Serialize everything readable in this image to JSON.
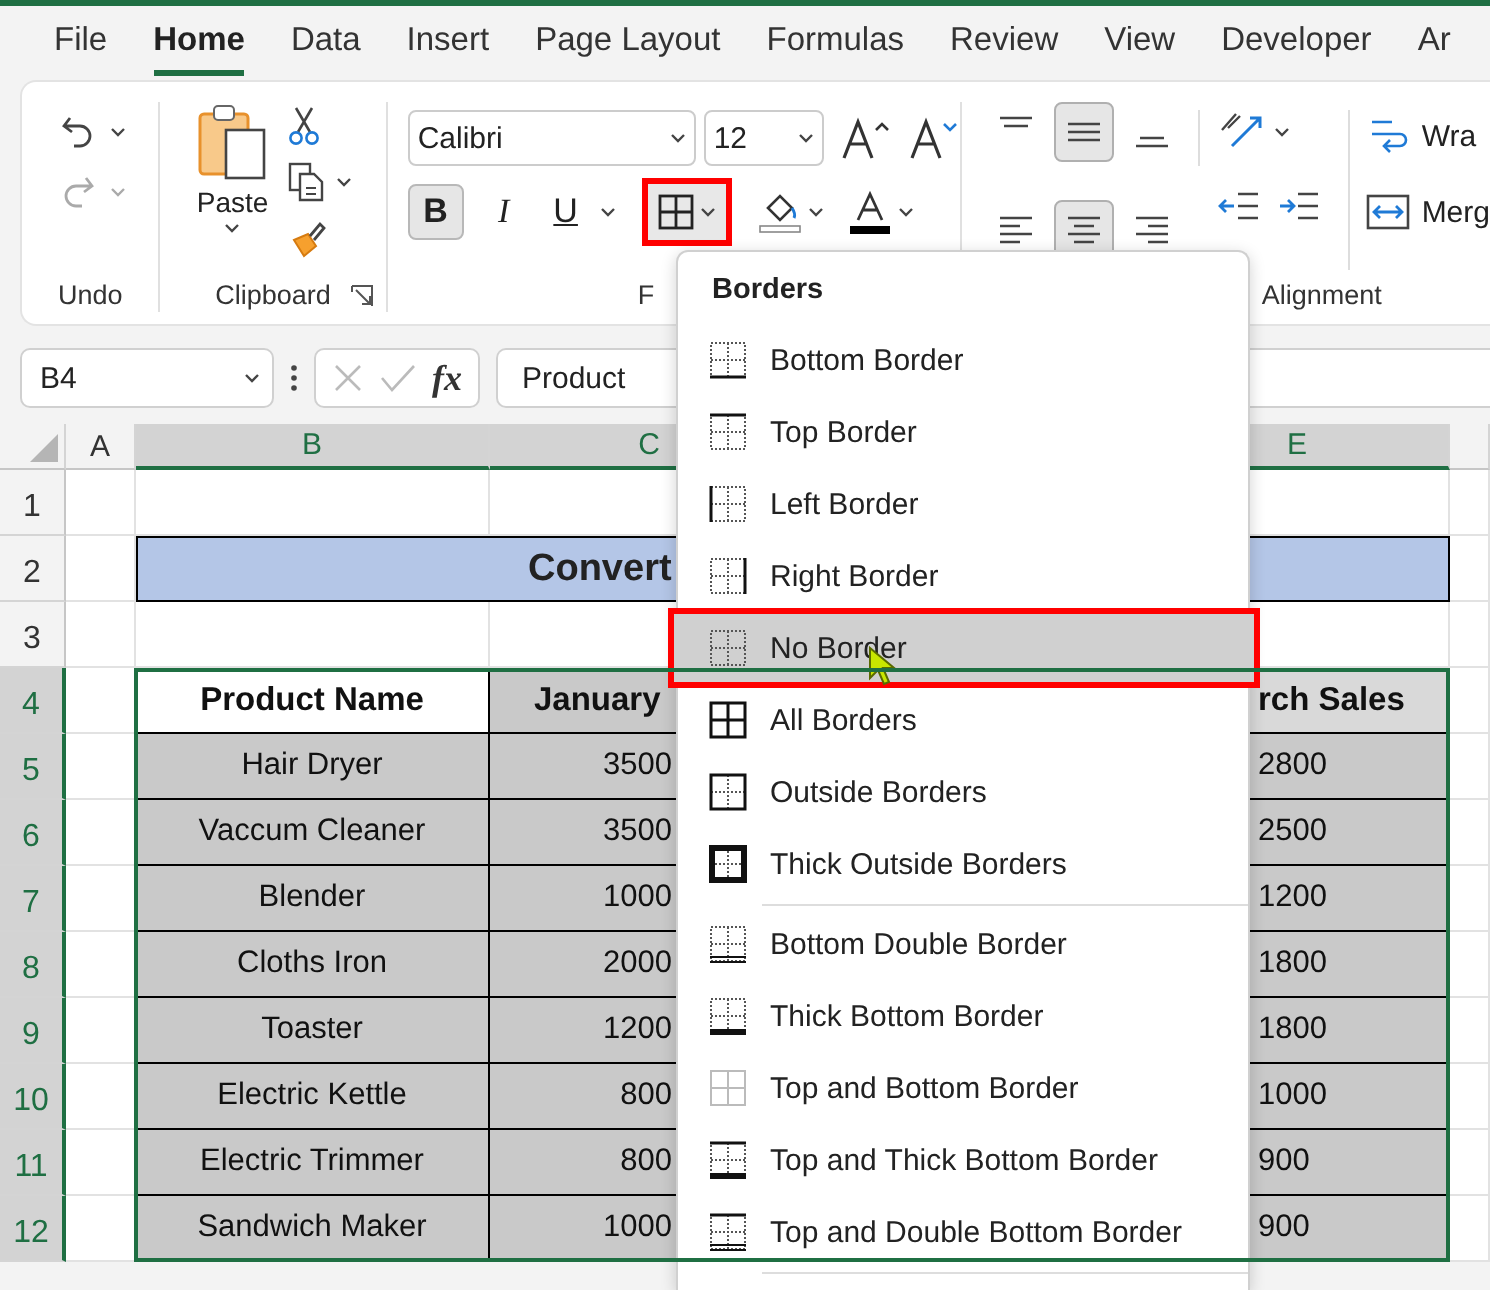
{
  "tabs": [
    {
      "label": "File",
      "selected": false
    },
    {
      "label": "Home",
      "selected": true
    },
    {
      "label": "Data",
      "selected": false
    },
    {
      "label": "Insert",
      "selected": false
    },
    {
      "label": "Page Layout",
      "selected": false
    },
    {
      "label": "Formulas",
      "selected": false
    },
    {
      "label": "Review",
      "selected": false
    },
    {
      "label": "View",
      "selected": false
    },
    {
      "label": "Developer",
      "selected": false
    },
    {
      "label": "Ar",
      "selected": false
    }
  ],
  "ribbon": {
    "groups": [
      {
        "kind": "undo",
        "label": "Undo"
      },
      {
        "kind": "clipboard",
        "label": "Clipboard",
        "paste_label": "Paste"
      },
      {
        "kind": "font",
        "label": "F",
        "font_name": "Calibri",
        "font_size": "12",
        "bold": {
          "label": "B",
          "on": true
        },
        "italic": "I",
        "underline": "U",
        "borders_highlighted": true
      },
      {
        "kind": "alignment",
        "label": "Alignment",
        "wrap_label": "Wra",
        "merge_label": "Merg",
        "align_buttons": [
          {
            "kind": "top",
            "selected": false
          },
          {
            "kind": "middle",
            "selected": true
          },
          {
            "kind": "bottom",
            "selected": false
          },
          {
            "kind": "left",
            "selected": false
          },
          {
            "kind": "center",
            "selected": true
          },
          {
            "kind": "right",
            "selected": false
          }
        ]
      }
    ]
  },
  "formula_bar": {
    "name_box": "B4",
    "function_label": "fx",
    "formula": "Product"
  },
  "sheet": {
    "columns": [
      {
        "label": "A",
        "selected": false
      },
      {
        "label": "B",
        "selected": true
      },
      {
        "label": "C",
        "selected": true
      },
      {
        "label": "E",
        "selected": true
      }
    ],
    "rows": [
      {
        "label": "1",
        "selected": false
      },
      {
        "label": "2",
        "selected": false
      },
      {
        "label": "3",
        "selected": false
      },
      {
        "label": "4",
        "selected": true
      },
      {
        "label": "5",
        "selected": true
      },
      {
        "label": "6",
        "selected": true
      },
      {
        "label": "7",
        "selected": true
      },
      {
        "label": "8",
        "selected": true
      },
      {
        "label": "9",
        "selected": true
      },
      {
        "label": "10",
        "selected": true
      },
      {
        "label": "11",
        "selected": true
      },
      {
        "label": "12",
        "selected": true
      }
    ],
    "title": "Convert",
    "table": {
      "headers": [
        "Product Name",
        "January",
        "rch Sales"
      ],
      "rows": [
        {
          "product_name": "Hair Dryer",
          "january": "3500",
          "sales": "2800"
        },
        {
          "product_name": "Vaccum Cleaner",
          "january": "3500",
          "sales": "2500"
        },
        {
          "product_name": "Blender",
          "january": "1000",
          "sales": "1200"
        },
        {
          "product_name": "Cloths Iron",
          "january": "2000",
          "sales": "1800"
        },
        {
          "product_name": "Toaster",
          "january": "1200",
          "sales": "1800"
        },
        {
          "product_name": "Electric Kettle",
          "january": "800",
          "sales": "1000"
        },
        {
          "product_name": "Electric Trimmer",
          "january": "800",
          "sales": "900"
        },
        {
          "product_name": "Sandwich Maker",
          "january": "1000",
          "sales": "900"
        }
      ]
    }
  },
  "menu": {
    "title": "Borders",
    "sections": [
      {
        "items": [
          {
            "label": "Bottom Border",
            "kind": "bottom",
            "selected": false
          },
          {
            "label": "Top Border",
            "kind": "top",
            "selected": false
          },
          {
            "label": "Left Border",
            "kind": "left",
            "selected": false
          },
          {
            "label": "Right Border",
            "kind": "right",
            "selected": false
          },
          {
            "label": "No Border",
            "kind": "none",
            "selected": true
          },
          {
            "label": "All Borders",
            "kind": "all",
            "selected": false
          },
          {
            "label": "Outside Borders",
            "kind": "outside",
            "selected": false
          },
          {
            "label": "Thick Outside Borders",
            "kind": "thick_outside",
            "selected": false
          }
        ]
      },
      {
        "items": [
          {
            "label": "Bottom Double Border",
            "kind": "bottom_double",
            "selected": false
          },
          {
            "label": "Thick Bottom Border",
            "kind": "thick_bottom",
            "selected": false
          },
          {
            "label": "Top and Bottom Border",
            "kind": "top_bottom",
            "selected": false
          },
          {
            "label": "Top and Thick Bottom Border",
            "kind": "top_thick_bottom",
            "selected": false
          },
          {
            "label": "Top and Double Bottom Border",
            "kind": "top_double_bottom",
            "selected": false
          }
        ]
      }
    ]
  }
}
